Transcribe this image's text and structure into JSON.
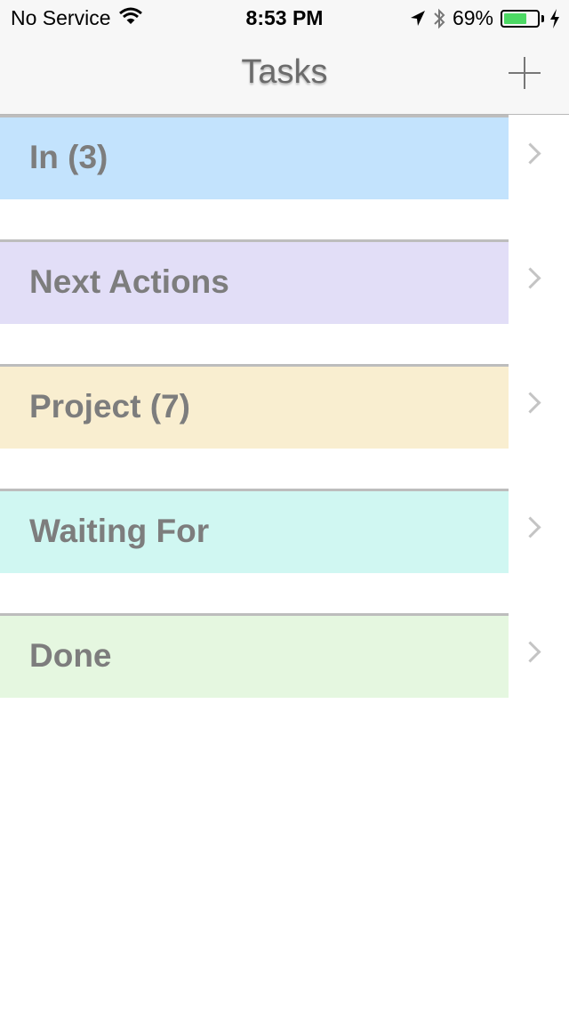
{
  "status_bar": {
    "carrier": "No Service",
    "time": "8:53 PM",
    "battery_percent": "69%",
    "battery_level": 0.69,
    "icons": [
      "wifi-icon",
      "location-arrow-icon",
      "bluetooth-icon",
      "battery-icon",
      "charging-bolt-icon"
    ]
  },
  "nav": {
    "title": "Tasks",
    "add_icon": "plus-icon"
  },
  "lists": [
    {
      "label": "In (3)",
      "color": "#c3e3fd"
    },
    {
      "label": "Next Actions",
      "color": "#e2def7"
    },
    {
      "label": "Project (7)",
      "color": "#f9eed0"
    },
    {
      "label": "Waiting For",
      "color": "#d0f7f2"
    },
    {
      "label": "Done",
      "color": "#e5f7e0"
    }
  ]
}
